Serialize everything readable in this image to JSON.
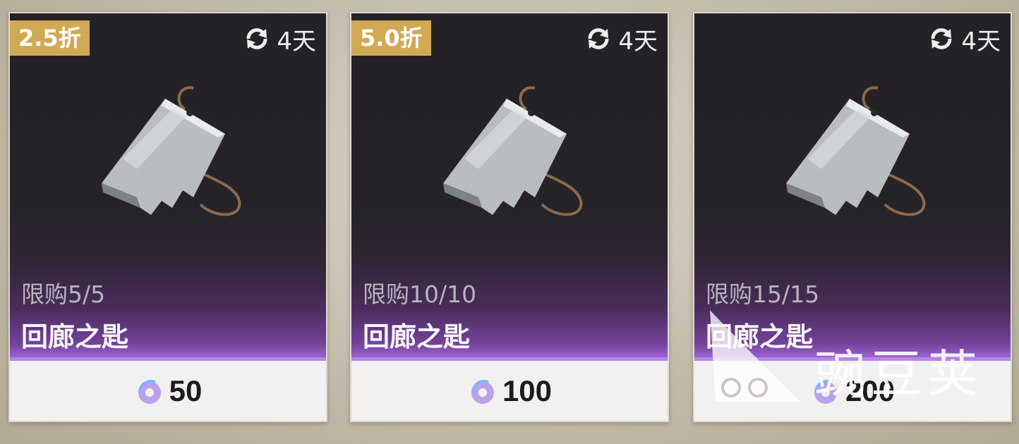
{
  "shop": {
    "items": [
      {
        "discount": "2.5折",
        "refresh": "4天",
        "limit": "限购5/5",
        "name": "回廊之匙",
        "price": "50"
      },
      {
        "discount": "5.0折",
        "refresh": "4天",
        "limit": "限购10/10",
        "name": "回廊之匙",
        "price": "100"
      },
      {
        "discount": "",
        "refresh": "4天",
        "limit": "限购15/15",
        "name": "回廊之匙",
        "price": "200"
      }
    ]
  },
  "watermark": {
    "text": "豌豆荚"
  },
  "colors": {
    "badge": "#d1a955",
    "accent_purple": "#b784e8",
    "card_dark": "#242226"
  }
}
